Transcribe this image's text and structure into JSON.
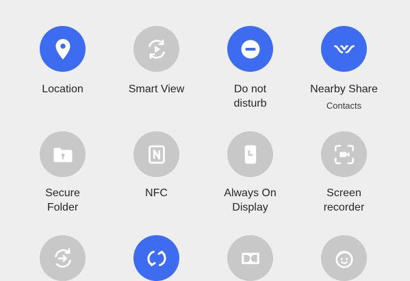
{
  "colors": {
    "active": "#3d6cf0",
    "inactive": "#c8c8c8",
    "background": "#eeeeee",
    "text": "#262626"
  },
  "tiles": [
    {
      "label": "Location",
      "icon": "location-pin-icon",
      "active": true
    },
    {
      "label": "Smart View",
      "icon": "smart-view-icon",
      "active": false
    },
    {
      "label_line1": "Do not",
      "label_line2": "disturb",
      "icon": "do-not-disturb-icon",
      "active": true
    },
    {
      "label": "Nearby Share",
      "sub": "Contacts",
      "icon": "nearby-share-icon",
      "active": true
    },
    {
      "label_line1": "Secure",
      "label_line2": "Folder",
      "icon": "secure-folder-icon",
      "active": false
    },
    {
      "label": "NFC",
      "icon": "nfc-icon",
      "active": false
    },
    {
      "label_line1": "Always On",
      "label_line2": "Display",
      "icon": "always-on-display-icon",
      "active": false
    },
    {
      "label_line1": "Screen",
      "label_line2": "recorder",
      "icon": "screen-recorder-icon",
      "active": false
    },
    {
      "icon": "sync-transfer-icon",
      "active": false
    },
    {
      "icon": "auto-rotate-icon",
      "active": true
    },
    {
      "icon": "dolby-atmos-icon",
      "active": false
    },
    {
      "icon": "kids-face-icon",
      "active": false
    }
  ]
}
